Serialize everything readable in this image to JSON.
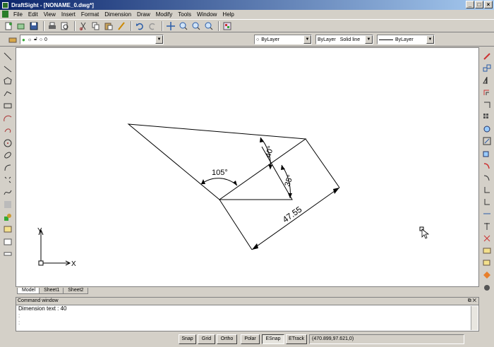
{
  "window": {
    "title": "DraftSight - [NONAME_0.dwg*]",
    "buttons": [
      "_",
      "□",
      "×"
    ]
  },
  "menu": [
    "File",
    "Edit",
    "View",
    "Insert",
    "Format",
    "Dimension",
    "Draw",
    "Modify",
    "Tools",
    "Window",
    "Help"
  ],
  "toolbar": {
    "layer_value": "0",
    "color_value": "ByLayer",
    "linetype_value": "ByLayer",
    "linestyle_value": "Solid line",
    "lineweight_value": "ByLayer"
  },
  "drawing": {
    "angle_105": "105°",
    "angle_40": "40°",
    "angle_35": "35°",
    "linear": "47.55",
    "axis_x": "X",
    "axis_y": "Y"
  },
  "tabs": [
    "Model",
    "Sheet1",
    "Sheet2"
  ],
  "command_window": {
    "title": "Command window",
    "line1": "Dimension text : 40",
    "line2": ":",
    "line3": ":"
  },
  "status": {
    "snap": "Snap",
    "grid": "Grid",
    "ortho": "Ortho",
    "polar": "Polar",
    "esnap": "ESnap",
    "etrack": "ETrack",
    "coords": "(470.899,97.621,0)"
  }
}
